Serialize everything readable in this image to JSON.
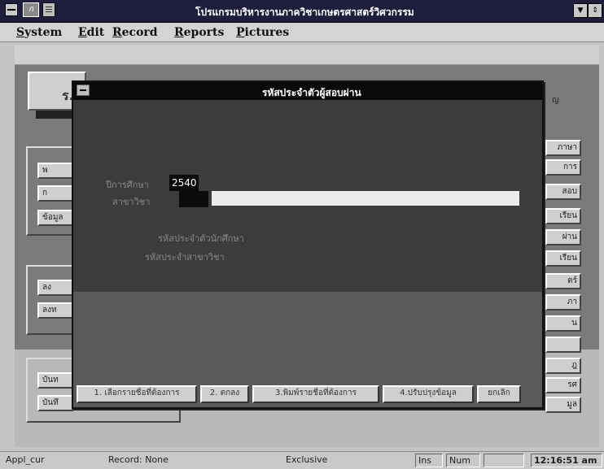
{
  "window": {
    "title": "โปรแกรมบริหารงานภาควิชาเกษตรศาสตร์วิศวกรรม"
  },
  "menu": [
    {
      "label": "System",
      "underline": "S",
      "rest": "ystem"
    },
    {
      "label": "Edit",
      "underline": "E",
      "rest": "dit"
    },
    {
      "label": "Record",
      "underline": "R",
      "rest": "ecord"
    },
    {
      "label": "Reports",
      "underline": "R",
      "rest": "eports"
    },
    {
      "label": "Pictures",
      "underline": "P",
      "rest": "ictures"
    }
  ],
  "background": {
    "header_glyph": "ร.",
    "right_label": "ญ",
    "left_buttons": [
      "พ",
      "ก",
      "ข้อมูล",
      "ลง",
      "ลงท",
      "บันท",
      "บันทึ"
    ],
    "right_tabs": [
      "ภาษา",
      "การ",
      "สอบ",
      "เรียน",
      "ผ่าน",
      "เรียน",
      "ตร์",
      "ภา",
      "น",
      "",
      "ฎ",
      "รศ",
      "มูล"
    ]
  },
  "dialog": {
    "title": "รหัสประจำตัวผู้สอบผ่าน",
    "year_label": "ปีการศึกษา",
    "year_value": "2540",
    "dept_label": "สาขาวิชา",
    "student_id_label": "รหัสประจำตัวนักศึกษา",
    "major_id_label": "รหัสประจำสาขาวิชา",
    "buttons": [
      "1. เลือกรายชื่อที่ต้องการ",
      "2. ตกลง",
      "3.พิมพ์รายชื่อที่ต้องการ",
      "4.ปรับปรุงข้อมูล",
      "ยกเลิก"
    ]
  },
  "status": {
    "appl": "Appl_cur",
    "record": "Record: None",
    "mode": "Exclusive",
    "ins": "Ins",
    "num": "Num",
    "time": "12:16:51 am"
  },
  "colors": {
    "title_bg": "#1e1e3c",
    "dialog_bg": "#4a4a4a"
  }
}
